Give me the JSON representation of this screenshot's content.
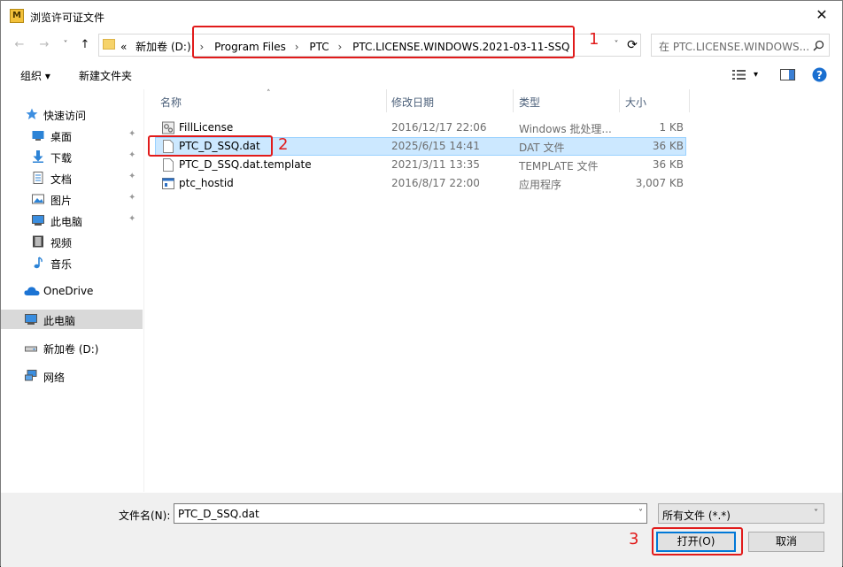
{
  "window": {
    "title": "浏览许可证文件",
    "app_icon_glyph": "M",
    "close_glyph": "✕"
  },
  "nav": {
    "back_glyph": "←",
    "forward_glyph": "→",
    "recent_glyph": "˅",
    "up_glyph": "↑"
  },
  "address": {
    "overflow": "«",
    "crumbs": [
      "新加卷 (D:)",
      "Program Files",
      "PTC",
      "PTC.LICENSE.WINDOWS.2021-03-11-SSQ"
    ],
    "separator": "›",
    "dropdown_glyph": "˅",
    "refresh_glyph": "⟳"
  },
  "search": {
    "placeholder": "在 PTC.LICENSE.WINDOWS..."
  },
  "toolbar": {
    "organize": "组织 ▾",
    "new_folder": "新建文件夹",
    "view_glyph": "▾"
  },
  "sidebar": {
    "items": [
      {
        "label": "快速访问",
        "icon": "star-icon",
        "pinned": false
      },
      {
        "label": "桌面",
        "icon": "desktop-icon",
        "pinned": true
      },
      {
        "label": "下载",
        "icon": "download-icon",
        "pinned": true
      },
      {
        "label": "文档",
        "icon": "document-icon",
        "pinned": true
      },
      {
        "label": "图片",
        "icon": "pictures-icon",
        "pinned": true
      },
      {
        "label": "此电脑",
        "icon": "computer-icon",
        "pinned": true
      },
      {
        "label": "视频",
        "icon": "video-icon",
        "pinned": false
      },
      {
        "label": "音乐",
        "icon": "music-icon",
        "pinned": false
      },
      {
        "label": "OneDrive",
        "icon": "cloud-icon",
        "pinned": false
      },
      {
        "label": "此电脑",
        "icon": "computer-icon",
        "pinned": false
      },
      {
        "label": "新加卷 (D:)",
        "icon": "drive-icon",
        "pinned": false
      },
      {
        "label": "网络",
        "icon": "network-icon",
        "pinned": false
      }
    ],
    "pin_glyph": "📌"
  },
  "columns": {
    "name": "名称",
    "modified": "修改日期",
    "type": "类型",
    "size": "大小",
    "sort_glyph": "˄"
  },
  "files": [
    {
      "name": "FillLicense",
      "modified": "2016/12/17 22:06",
      "type": "Windows 批处理...",
      "size": "1 KB",
      "icon": "batch-file-icon"
    },
    {
      "name": "PTC_D_SSQ.dat",
      "modified": "2025/6/15 14:41",
      "type": "DAT 文件",
      "size": "36 KB",
      "icon": "file-icon"
    },
    {
      "name": "PTC_D_SSQ.dat.template",
      "modified": "2021/3/11 13:35",
      "type": "TEMPLATE 文件",
      "size": "36 KB",
      "icon": "file-icon"
    },
    {
      "name": "ptc_hostid",
      "modified": "2016/8/17 22:00",
      "type": "应用程序",
      "size": "3,007 KB",
      "icon": "application-icon"
    }
  ],
  "footer": {
    "filename_label": "文件名(N):",
    "filename_value": "PTC_D_SSQ.dat",
    "filetype_value": "所有文件 (*.*)",
    "open_label": "打开(O)",
    "cancel_label": "取消",
    "dropdown_glyph": "˅"
  },
  "annotations": {
    "step1": "1",
    "step2": "2",
    "step3": "3",
    "color": "#e11b1b"
  },
  "colors": {
    "selection": "#cce8ff",
    "accent": "#0078d7"
  }
}
